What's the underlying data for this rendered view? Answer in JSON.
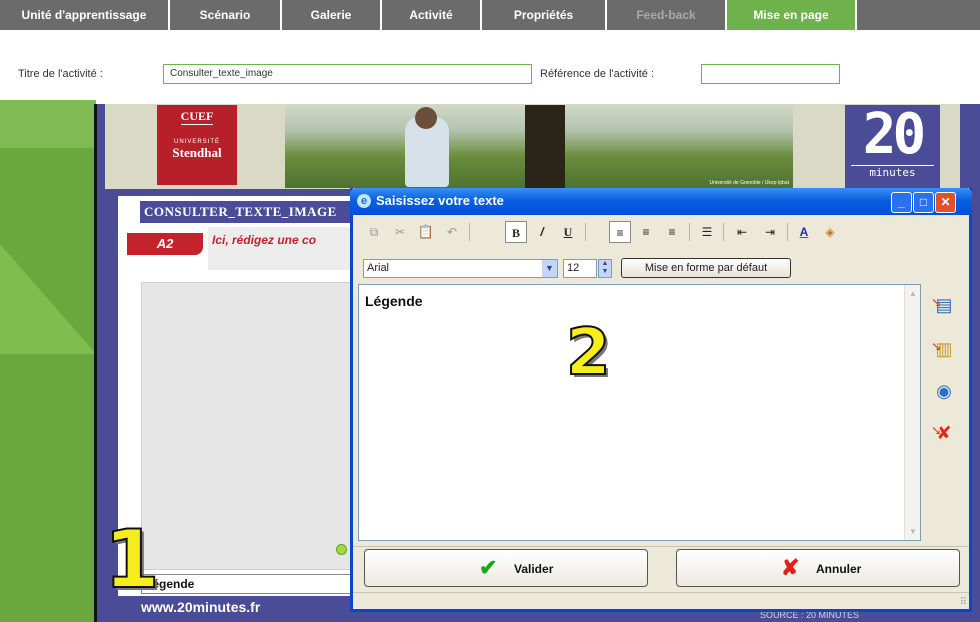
{
  "tabs": [
    {
      "label": "Unité d'apprentissage",
      "state": "normal"
    },
    {
      "label": "Scénario",
      "state": "normal"
    },
    {
      "label": "Galerie",
      "state": "normal"
    },
    {
      "label": "Activité",
      "state": "normal"
    },
    {
      "label": "Propriétés",
      "state": "normal"
    },
    {
      "label": "Feed-back",
      "state": "disabled"
    },
    {
      "label": "Mise en page",
      "state": "active"
    }
  ],
  "form": {
    "title_label": "Titre de l'activité :",
    "title_value": "Consulter_texte_image",
    "reference_label": "Référence de l'activité :",
    "reference_value": ""
  },
  "banner": {
    "cuef_title": "CUEF",
    "cuef_sub": "UNIVERSITÉ",
    "cuef_name": "Stendhal",
    "photo_credit": "Université de Grenoble / Ukop Ipbat",
    "twenty_big": "20",
    "twenty_small": "minutes"
  },
  "content": {
    "activity_title": "CONSULTER_TEXTE_IMAGE",
    "level_badge": "A2",
    "instruction": "Ici, rédigez une co",
    "legend": "Légende",
    "footer_url": "www.20minutes.fr",
    "footer_right": "SOURCE : 20 MINUTES"
  },
  "callouts": {
    "one": "1",
    "two": "2"
  },
  "dialog": {
    "title": "Saisissez votre texte",
    "window_buttons": {
      "minimize": "_",
      "maximize": "□",
      "close": "✕"
    },
    "toolbar": [
      {
        "icon": "copy-icon",
        "glyph": "⧉",
        "state": "dim"
      },
      {
        "icon": "cut-icon",
        "glyph": "✂",
        "state": "dim"
      },
      {
        "icon": "paste-icon",
        "glyph": "📋",
        "state": "normal"
      },
      {
        "icon": "undo-icon",
        "glyph": "↶",
        "state": "dim"
      },
      {
        "icon": "bold-icon",
        "glyph": "B",
        "state": "pressed"
      },
      {
        "icon": "italic-icon",
        "glyph": "/",
        "state": "normal"
      },
      {
        "icon": "underline-icon",
        "glyph": "U",
        "state": "normal"
      },
      {
        "icon": "align-left-icon",
        "glyph": "≡",
        "state": "pressed"
      },
      {
        "icon": "align-center-icon",
        "glyph": "≡",
        "state": "normal"
      },
      {
        "icon": "align-right-icon",
        "glyph": "≡",
        "state": "normal"
      },
      {
        "icon": "bullet-list-icon",
        "glyph": "☰",
        "state": "normal"
      },
      {
        "icon": "outdent-icon",
        "glyph": "⇤",
        "state": "normal"
      },
      {
        "icon": "indent-icon",
        "glyph": "⇥",
        "state": "normal"
      },
      {
        "icon": "font-color-icon",
        "glyph": "A",
        "state": "normal"
      },
      {
        "icon": "highlight-color-icon",
        "glyph": "◈",
        "state": "normal"
      }
    ],
    "font_name": "Arial",
    "font_size": "12",
    "default_format_button": "Mise en forme par défaut",
    "editor_text": "Légende",
    "side_icons": [
      {
        "icon": "insert-text-icon",
        "glyph": "▤"
      },
      {
        "icon": "paste-text-icon",
        "glyph": "▥"
      },
      {
        "icon": "web-link-icon",
        "glyph": "◉"
      },
      {
        "icon": "delete-icon",
        "glyph": "✘"
      }
    ],
    "ok_button": "Valider",
    "cancel_button": "Annuler"
  },
  "colors": {
    "accent_green": "#6fb24b",
    "page_blue": "#4a4c98",
    "xp_title_blue": "#0a5fe0",
    "callout_yellow": "#f5ee1c",
    "level_red": "#c4232b"
  }
}
